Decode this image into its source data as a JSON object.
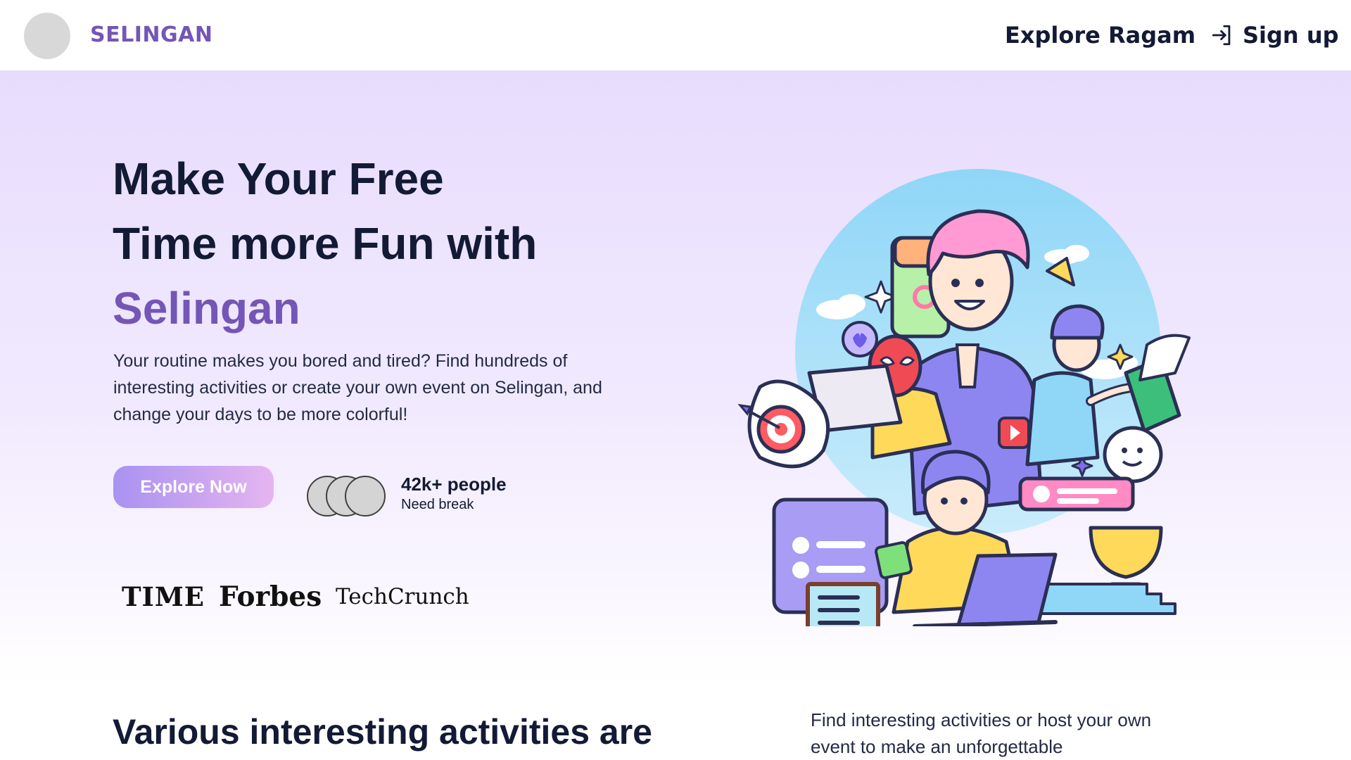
{
  "navbar": {
    "brand": "SELINGAN",
    "nav_link": "Explore Ragam",
    "signup_label": "Sign up",
    "signup_icon": "sign-in-icon"
  },
  "hero": {
    "headline_line1": "Make Your Free",
    "headline_line2": "Time more Fun with",
    "headline_accent": "Selingan",
    "subtext": "Your routine makes you bored and tired? Find hundreds of interesting activities or create your own event on Selingan, and change your days to be more colorful!",
    "cta_label": "Explore Now",
    "stat_value": "42k+ people",
    "stat_label": "Need break",
    "press": [
      "TIME",
      "Forbes",
      "TechCrunch"
    ]
  },
  "section": {
    "title": "Various interesting activities are",
    "description": "Find interesting activities or host your own event to make an unforgettable"
  },
  "colors": {
    "brand": "#7356b5",
    "text_dark": "#131a35",
    "hero_bg_top": "#e8dcfd",
    "cta_start": "#a992f1",
    "cta_end": "#e5b5f0"
  }
}
